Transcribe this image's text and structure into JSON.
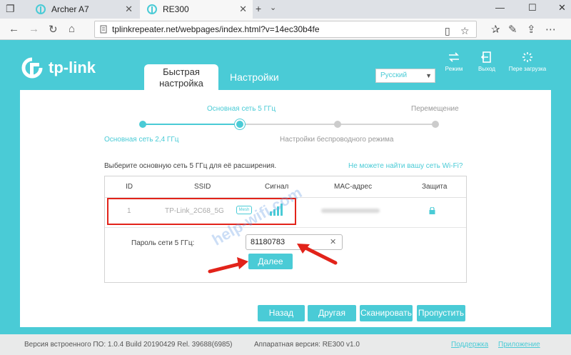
{
  "browser": {
    "tabs": [
      {
        "title": "Archer A7"
      },
      {
        "title": "RE300"
      }
    ],
    "url": "tplinkrepeater.net/webpages/index.html?v=14ec30b4fe"
  },
  "header": {
    "brand": "tp-link",
    "tabs": [
      {
        "label_line1": "Быстрая",
        "label_line2": "настройка"
      },
      {
        "label": "Настройки"
      }
    ],
    "language": "Русский",
    "actions": [
      {
        "label": "Режим",
        "icon": "mode-icon"
      },
      {
        "label": "Выход",
        "icon": "logout-icon"
      },
      {
        "label": "Пере загрузка",
        "icon": "reboot-icon"
      }
    ]
  },
  "steps": {
    "step1": "Основная сеть 2,4 ГГц",
    "step2": "Основная сеть 5 ГГц",
    "step3": "Настройки беспроводного режима",
    "step4": "Перемещение",
    "current": 2
  },
  "networks": {
    "prompt": "Выберите основную сеть 5 ГГц для её расширения.",
    "cant_find": "Не можете найти вашу сеть Wi-Fi?",
    "columns": [
      "ID",
      "SSID",
      "Сигнал",
      "MAC-адрес",
      "Защита"
    ],
    "rows": [
      {
        "id": "1",
        "ssid": "TP-Link_2C68_5G",
        "badge": "Mesh",
        "signal_level": 4
      }
    ],
    "password_label": "Пароль сети 5 ГГц:",
    "password_value": "81180783",
    "next_label": "Далее"
  },
  "watermark": "help-wifi.com",
  "buttons": {
    "back": "Назад",
    "other": "Другая",
    "scan": "Сканировать",
    "skip": "Пропустить"
  },
  "footer": {
    "firmware": "Версия встроенного ПО: 1.0.4 Build 20190429 Rel. 39688(6985)",
    "hardware": "Аппаратная версия: RE300 v1.0",
    "support": "Поддержка",
    "app": "Приложение"
  },
  "colors": {
    "accent": "#4acbd6",
    "highlight": "#e2231a"
  }
}
